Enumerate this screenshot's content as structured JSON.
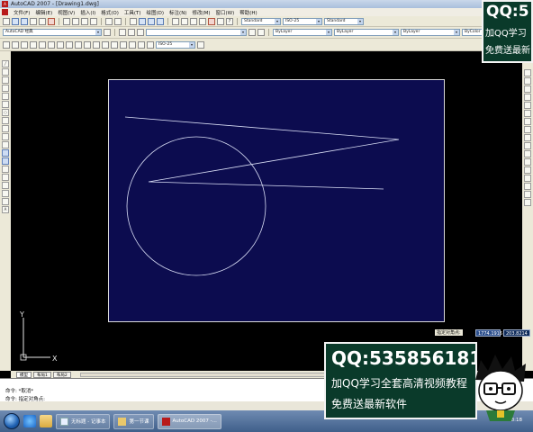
{
  "window": {
    "title": "AutoCAD 2007 - [Drawing1.dwg]"
  },
  "menu": [
    "文件(F)",
    "编辑(E)",
    "视图(V)",
    "插入(I)",
    "格式(O)",
    "工具(T)",
    "绘图(D)",
    "标注(N)",
    "修改(M)",
    "窗口(W)",
    "帮助(H)"
  ],
  "toolbar": {
    "workspace": "AutoCAD 经典",
    "text_style": "Standard",
    "dim_style": "ISO-25",
    "table_style": "Standard",
    "layer_color": "ByLayer",
    "linetype": "ByLayer",
    "lineweight": "ByLayer",
    "plot_style": "ByColor",
    "dim_style_2": "ISO-25"
  },
  "layout_tabs": [
    "模型",
    "布局1",
    "布局2"
  ],
  "ucs": {
    "x_label": "X",
    "y_label": "Y"
  },
  "status": {
    "prompt_label": "指定对角点:",
    "coord_x": "1774.1916",
    "coord_y": "203.8214"
  },
  "command": {
    "line1": "命令: *取消*",
    "line2": "命令: 指定对角点:"
  },
  "taskbar": {
    "items": [
      {
        "label": "无标题 - 记事本"
      },
      {
        "label": "第一节课"
      },
      {
        "label": "AutoCAD 2007 -..."
      }
    ],
    "clock": "18:18"
  },
  "watermark": {
    "top": {
      "line1": "QQ:5",
      "line2": "加QQ学习",
      "line3": "免费送最新"
    },
    "bottom": {
      "line1": "QQ:535856181",
      "line2": "加QQ学习全套高清视频教程",
      "line3": "免费送最新软件"
    }
  },
  "colors": {
    "paper_background": "#0c0c4f",
    "geometry_stroke": "#d9def5",
    "model_space": "#000000",
    "watermark_background": "#0a3a2a"
  }
}
